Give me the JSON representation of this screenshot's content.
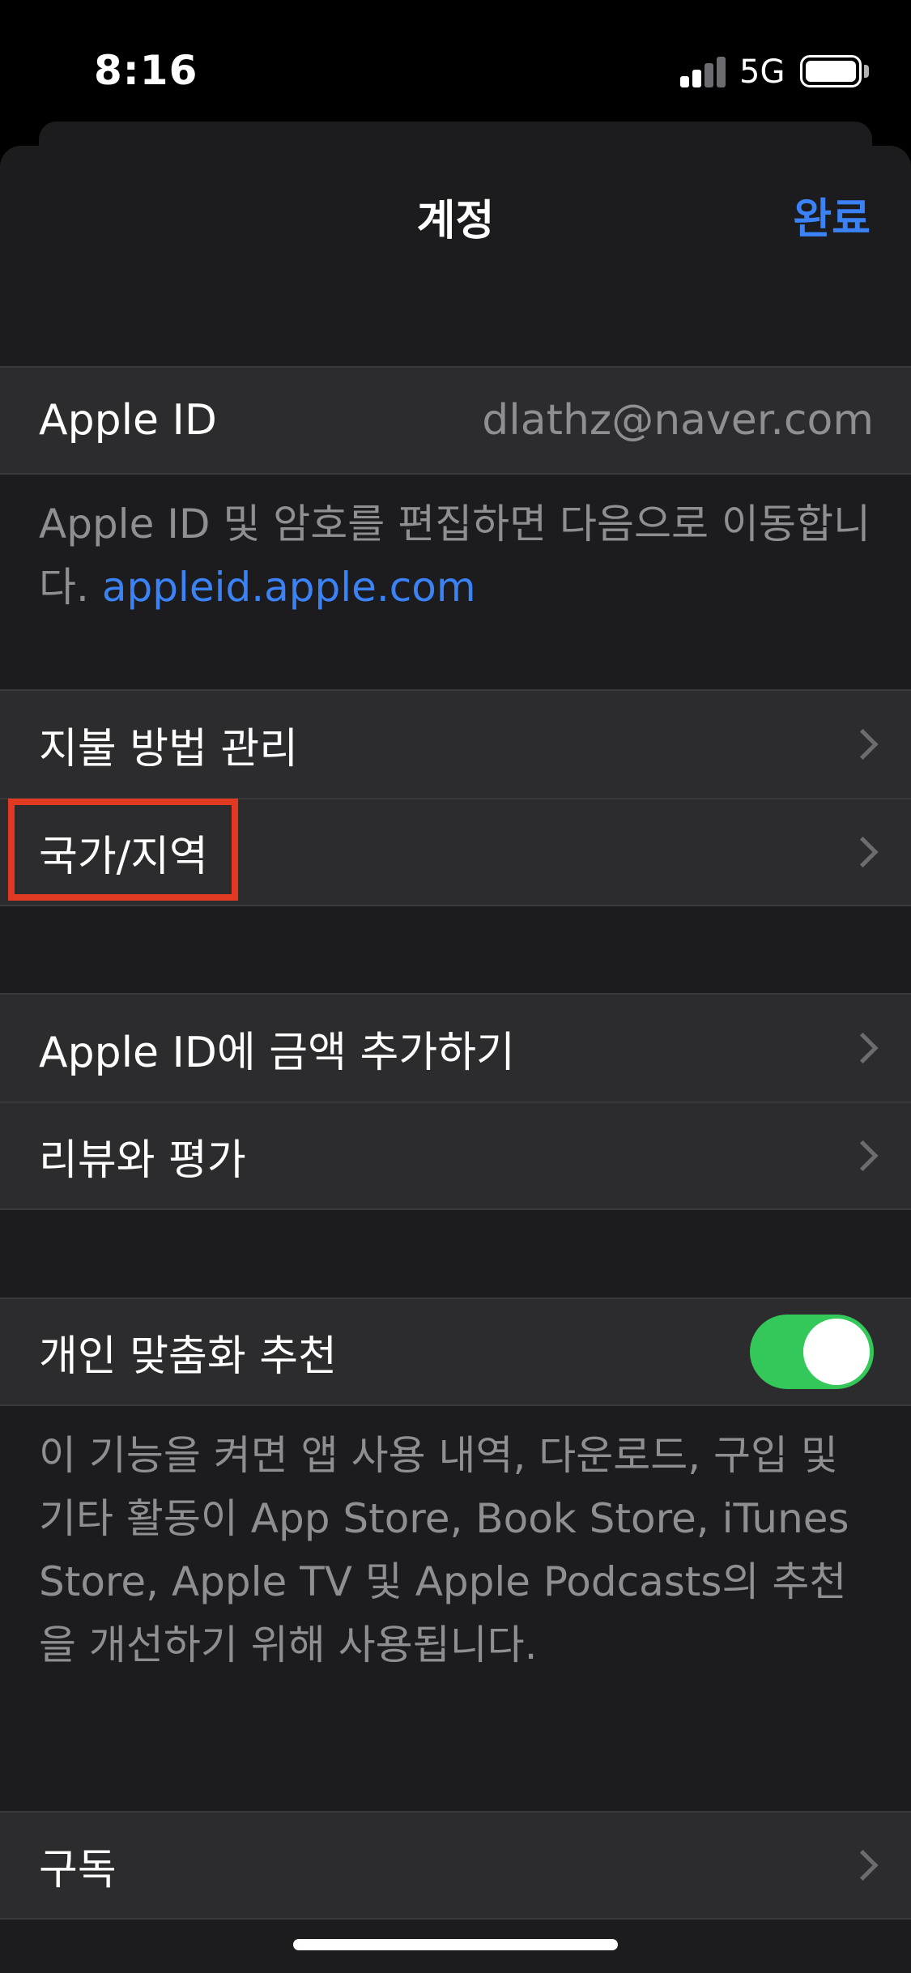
{
  "status_bar": {
    "time": "8:16",
    "network": "5G"
  },
  "header": {
    "title": "계정",
    "done_label": "완료"
  },
  "apple_id": {
    "label": "Apple ID",
    "value": "dlathz@naver.com",
    "footnote": "Apple ID 및 암호를 편집하면 다음으로 이동합니다.",
    "footnote_link": "appleid.apple.com"
  },
  "section_payment": [
    {
      "label": "지불 방법 관리"
    },
    {
      "label": "국가/지역"
    }
  ],
  "section_funds": [
    {
      "label": "Apple ID에 금액 추가하기"
    },
    {
      "label": "리뷰와 평가"
    }
  ],
  "personalization": {
    "label": "개인 맞춤화 추천",
    "enabled": true,
    "footnote": "이 기능을 켜면 앱 사용 내역, 다운로드, 구입 및 기타 활동이 App Store, Book Store, iTunes Store, Apple TV 및 Apple Podcasts의 추천을 개선하기 위해 사용됩니다."
  },
  "subscriptions": {
    "label": "구독"
  },
  "colors": {
    "accent": "#3b82f6",
    "toggle_on": "#34c759",
    "highlight": "#e23a22",
    "cell_bg": "#2c2c2e",
    "sheet_bg": "#1c1c1e"
  }
}
